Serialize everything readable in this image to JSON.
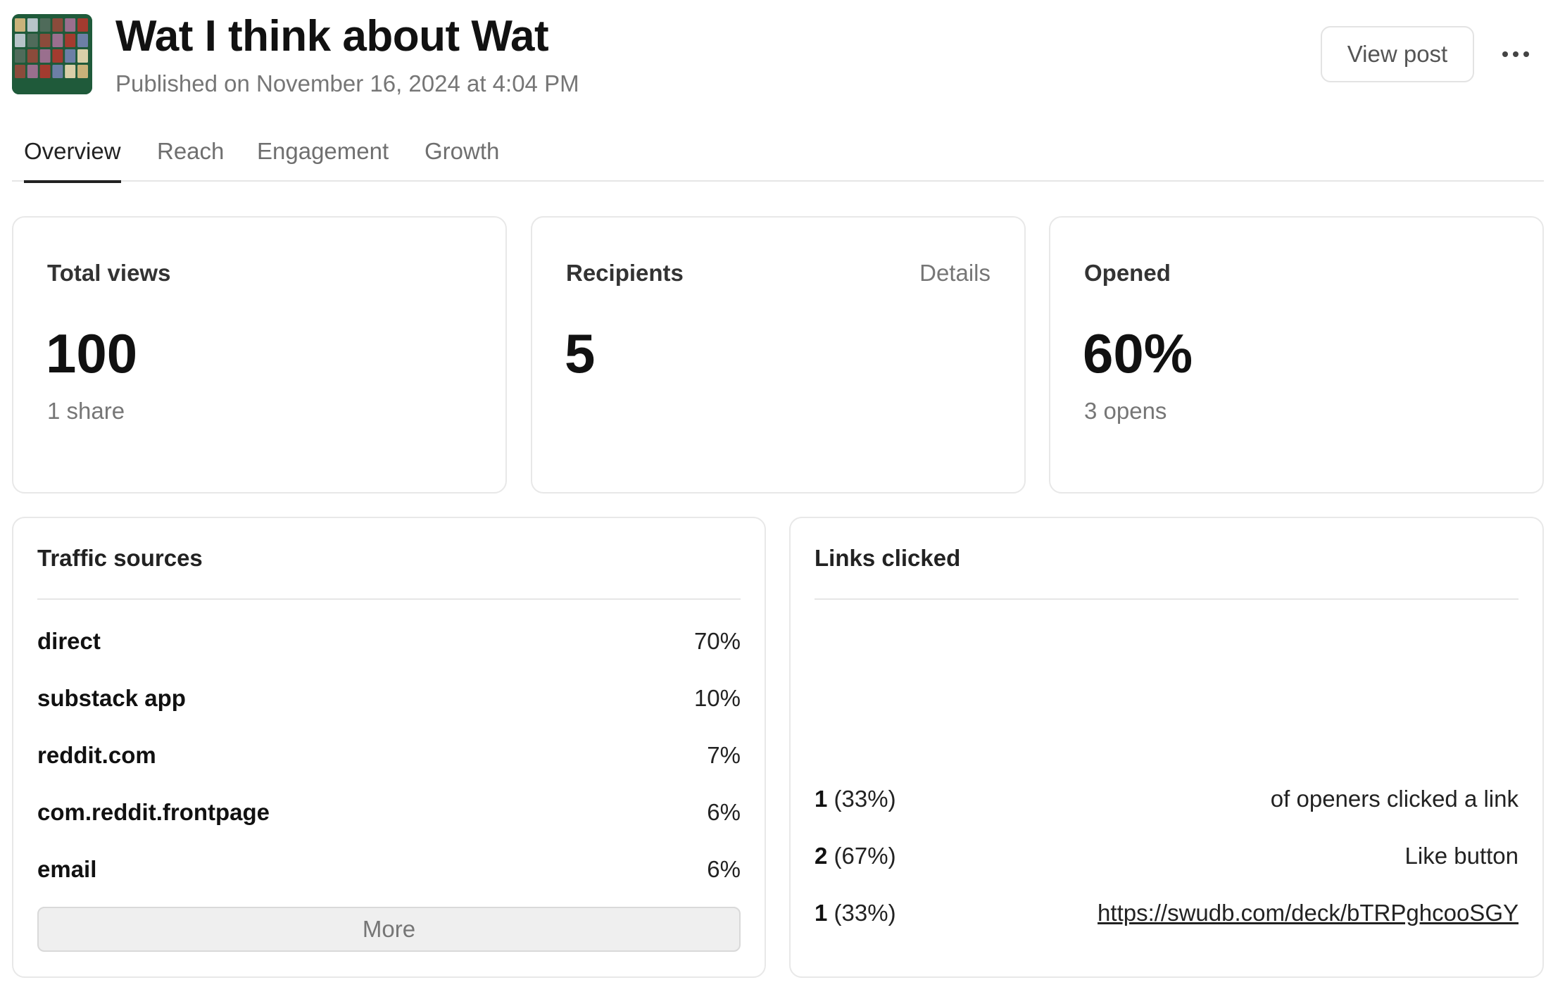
{
  "header": {
    "title": "Wat I think about Wat",
    "published": "Published on November 16, 2024 at 4:04 PM",
    "view_post_label": "View post",
    "more_icon": "ellipsis-icon",
    "thumbnail": "post-thumbnail-card-grid"
  },
  "tabs": [
    {
      "label": "Overview",
      "active": true
    },
    {
      "label": "Reach",
      "active": false
    },
    {
      "label": "Engagement",
      "active": false
    },
    {
      "label": "Growth",
      "active": false
    }
  ],
  "stats": {
    "total_views": {
      "label": "Total views",
      "value": "100",
      "sub": "1 share"
    },
    "recipients": {
      "label": "Recipients",
      "value": "5",
      "details_label": "Details"
    },
    "opened": {
      "label": "Opened",
      "value": "60%",
      "sub": "3 opens"
    }
  },
  "traffic_sources": {
    "title": "Traffic sources",
    "rows": [
      {
        "source": "direct",
        "percent": "70%"
      },
      {
        "source": "substack app",
        "percent": "10%"
      },
      {
        "source": "reddit.com",
        "percent": "7%"
      },
      {
        "source": "com.reddit.frontpage",
        "percent": "6%"
      },
      {
        "source": "email",
        "percent": "6%"
      }
    ],
    "more_label": "More"
  },
  "links_clicked": {
    "title": "Links clicked",
    "rows": [
      {
        "count": "1",
        "pct": "(33%)",
        "label": "of openers clicked a link",
        "is_link": false
      },
      {
        "count": "2",
        "pct": "(67%)",
        "label": "Like button",
        "is_link": false
      },
      {
        "count": "1",
        "pct": "(33%)",
        "label": "https://swudb.com/deck/bTRPghcooSGY",
        "is_link": true
      }
    ]
  },
  "colors": {
    "text": "#111111",
    "muted": "#767676",
    "border": "#e8e8e8",
    "thumb_green": "#1f5a3a"
  }
}
